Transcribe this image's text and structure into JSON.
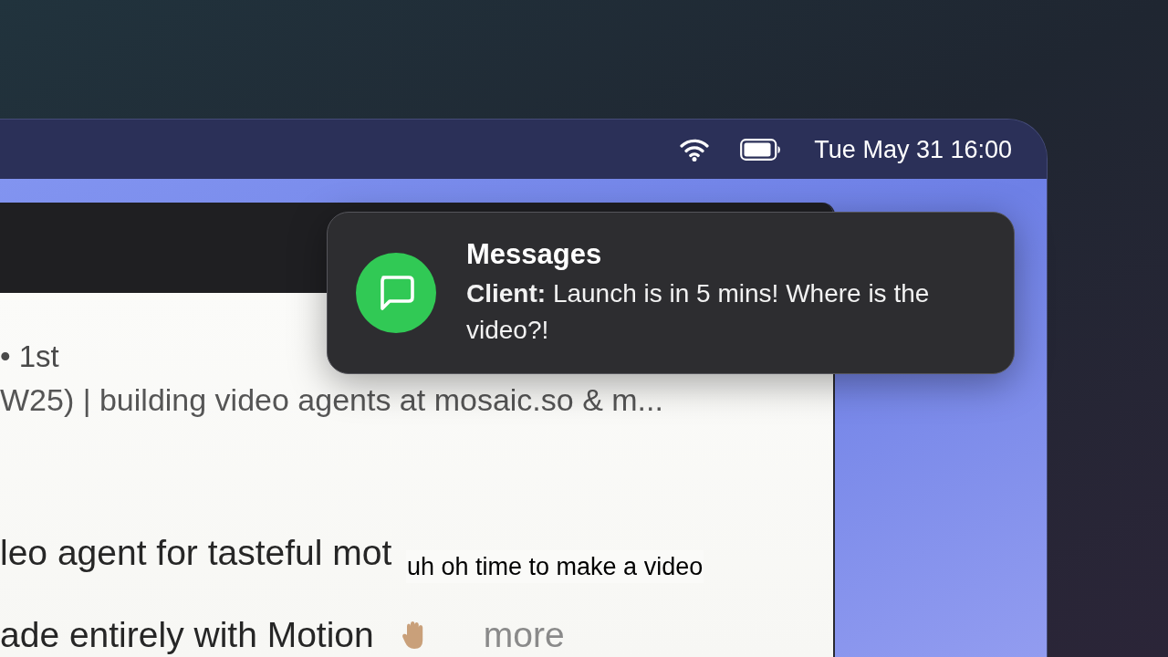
{
  "menu_bar": {
    "clock": "Tue May 31 16:00"
  },
  "window": {
    "lines": [
      {
        "kind": "meta",
        "text": "• 1st"
      },
      {
        "kind": "headline",
        "text": "W25) | building video agents at mosaic.so & m..."
      },
      {
        "kind": "body",
        "text": "leo agent for tasteful mot"
      },
      {
        "kind": "body",
        "text": "ade entirely with Motion",
        "more": "more"
      }
    ]
  },
  "notification": {
    "app": "Messages",
    "message": "**Client:** Launch is in 5 mins! Where is the video?!"
  },
  "caption": "uh oh time to make a video"
}
